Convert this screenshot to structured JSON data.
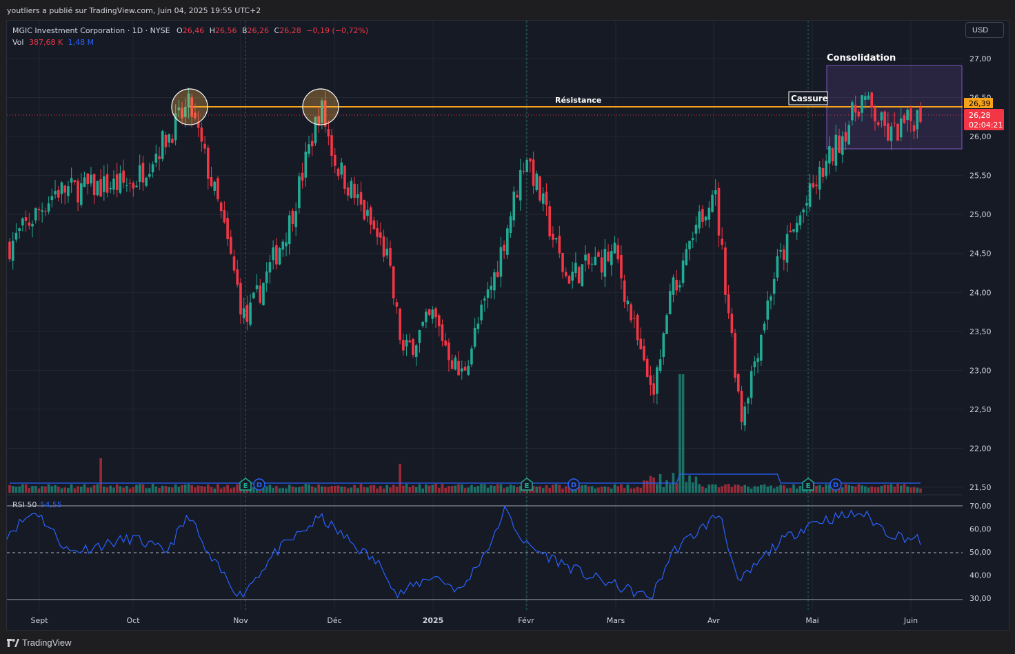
{
  "header": {
    "published": "youtliers a publié sur TradingView.com, Juin 04, 2025 19:55 UTC+2"
  },
  "legend": {
    "symbol": "MGIC Investment Corporation · 1D · NYSE",
    "o_label": "O",
    "o": "26,46",
    "h_label": "H",
    "h": "26,56",
    "b_label": "B",
    "b": "26,26",
    "c_label": "C",
    "c": "26,28",
    "change": "−0,19 (−0,72%)",
    "vol_label": "Vol",
    "vol": "387,68 K",
    "vol_ma": "1,48 M"
  },
  "currency": "USD",
  "annotations": {
    "consolidation": "Consolidation",
    "resistance": "Résistance",
    "cassure": "Cassure"
  },
  "price_labels": {
    "resistance": "26,39",
    "last": "26,28",
    "countdown": "02:04:21"
  },
  "rsi": {
    "label": "RSI 50",
    "value": "54,55"
  },
  "footer": {
    "brand": "TradingView"
  },
  "colors": {
    "up": "#22ab94",
    "down": "#f23645",
    "resistance": "#f7a21b",
    "rsi": "#2962ff",
    "box": "#7e57c2"
  },
  "chart_data": {
    "type": "candlestick",
    "x_ticks": [
      "Sept",
      "Oct",
      "Nov",
      "Déc",
      "2025",
      "Févr",
      "Mars",
      "Avr",
      "Mai",
      "Juin"
    ],
    "y_ticks": [
      "27,00",
      "26,50",
      "26,00",
      "25,50",
      "25,00",
      "24,50",
      "24,00",
      "23,50",
      "23,00",
      "22,50",
      "22,00",
      "21,50"
    ],
    "rsi_ticks": [
      "70,00",
      "60,00",
      "50,00",
      "40,00",
      "30,00"
    ],
    "ylim": [
      21.5,
      27.0
    ],
    "resistance_level": 26.39,
    "last_price": 26.28,
    "events": [
      "E",
      "D",
      "E",
      "D",
      "E",
      "D"
    ],
    "anchors": [
      {
        "x": "Sept",
        "close": 24.6
      },
      {
        "x": "Sept (mid)",
        "close": 25.3
      },
      {
        "x": "Oct",
        "close": 25.4
      },
      {
        "x": "Oct (peak)",
        "close": 26.4
      },
      {
        "x": "Oct (end)",
        "close": 25.0
      },
      {
        "x": "Nov",
        "close": 23.6
      },
      {
        "x": "Nov (mid)",
        "close": 24.9
      },
      {
        "x": "Déc (peak)",
        "close": 26.4
      },
      {
        "x": "Déc",
        "close": 25.7
      },
      {
        "x": "Déc (mid)",
        "close": 24.5
      },
      {
        "x": "Déc (end)",
        "close": 23.2
      },
      {
        "x": "2025",
        "close": 23.7
      },
      {
        "x": "2025 (mid)",
        "close": 22.9
      },
      {
        "x": "2025 (end)",
        "close": 24.3
      },
      {
        "x": "Févr",
        "close": 25.8
      },
      {
        "x": "Févr (mid)",
        "close": 24.2
      },
      {
        "x": "Mars",
        "close": 24.5
      },
      {
        "x": "Mars (mid)",
        "close": 22.6
      },
      {
        "x": "Mars (end)",
        "close": 24.0
      },
      {
        "x": "Avr",
        "close": 25.4
      },
      {
        "x": "Avr (mid)",
        "close": 22.4
      },
      {
        "x": "Avr (end)",
        "close": 24.3
      },
      {
        "x": "Mai",
        "close": 25.3
      },
      {
        "x": "Mai (mid)",
        "close": 26.5
      },
      {
        "x": "Mai (end)",
        "close": 26.0
      },
      {
        "x": "Juin",
        "close": 26.3
      }
    ],
    "rsi_anchors": [
      {
        "x": "Sept",
        "rsi": 58
      },
      {
        "x": "Sept (early)",
        "rsi": 68
      },
      {
        "x": "Sept (mid)",
        "rsi": 50
      },
      {
        "x": "Oct",
        "rsi": 56
      },
      {
        "x": "Oct (mid)",
        "rsi": 50
      },
      {
        "x": "Oct (peak)",
        "rsi": 66
      },
      {
        "x": "Oct (end)",
        "rsi": 49
      },
      {
        "x": "Nov",
        "rsi": 31
      },
      {
        "x": "Nov (mid)",
        "rsi": 50
      },
      {
        "x": "Déc (peak)",
        "rsi": 65
      },
      {
        "x": "Déc",
        "rsi": 60
      },
      {
        "x": "Déc (mid)",
        "rsi": 42
      },
      {
        "x": "Déc (end)",
        "rsi": 31
      },
      {
        "x": "2025",
        "rsi": 40
      },
      {
        "x": "2025 (mid)",
        "rsi": 33
      },
      {
        "x": "2025 (end)",
        "rsi": 58
      },
      {
        "x": "Févr",
        "rsi": 69
      },
      {
        "x": "Févr (mid)",
        "rsi": 53
      },
      {
        "x": "Mars",
        "rsi": 40
      },
      {
        "x": "Mars (mid)",
        "rsi": 30
      },
      {
        "x": "Mars (end)",
        "rsi": 50
      },
      {
        "x": "Avr",
        "rsi": 67
      },
      {
        "x": "Avr (mid)",
        "rsi": 36
      },
      {
        "x": "Avr (end)",
        "rsi": 53
      },
      {
        "x": "Mai",
        "rsi": 63
      },
      {
        "x": "Mai (mid)",
        "rsi": 67
      },
      {
        "x": "Mai (end)",
        "rsi": 58
      },
      {
        "x": "Juin",
        "rsi": 55
      }
    ]
  }
}
